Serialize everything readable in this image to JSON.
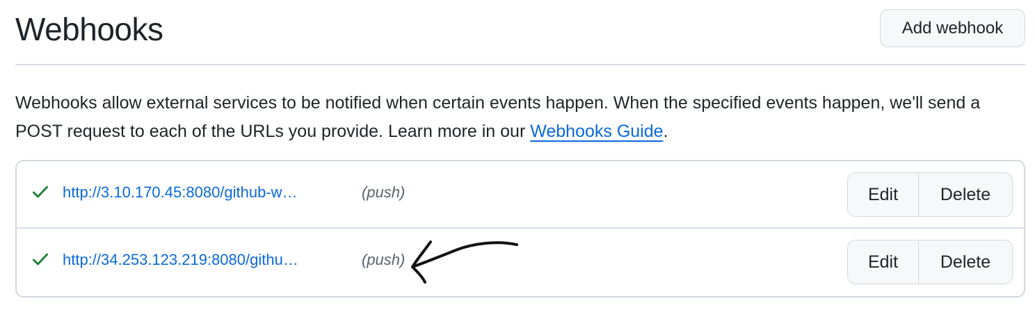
{
  "header": {
    "title": "Webhooks",
    "add_button_label": "Add webhook"
  },
  "intro": {
    "text": "Webhooks allow external services to be notified when certain events happen. When the specified events happen, we'll send a POST request to each of the URLs you provide. Learn more in our ",
    "link_label": "Webhooks Guide",
    "suffix": "."
  },
  "webhooks": [
    {
      "url": "http://3.10.170.45:8080/github-w…",
      "events": "(push)",
      "status_icon": "check-icon",
      "edit_label": "Edit",
      "delete_label": "Delete"
    },
    {
      "url": "http://34.253.123.219:8080/githu…",
      "events": "(push)",
      "status_icon": "check-icon",
      "edit_label": "Edit",
      "delete_label": "Delete"
    }
  ],
  "colors": {
    "link": "#0969da",
    "success": "#1a7f37",
    "border": "#d1d9e0",
    "button_bg": "#f6f8fa"
  },
  "annotation": {
    "icon": "hand-drawn-arrow-icon"
  }
}
